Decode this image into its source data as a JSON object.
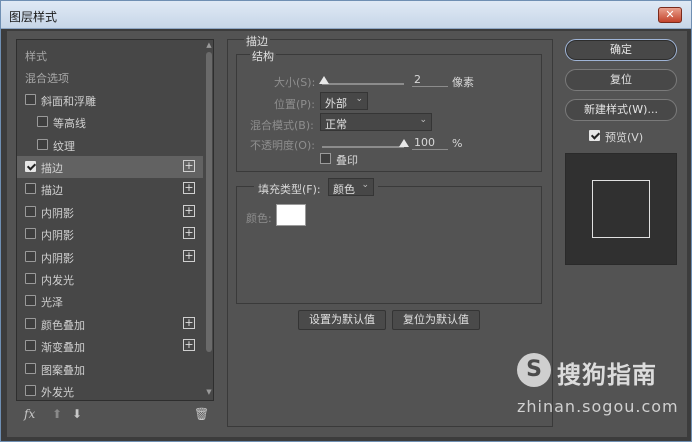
{
  "window": {
    "title": "图层样式",
    "close_label": "✕"
  },
  "styles_list": {
    "items": [
      {
        "label": "样式",
        "checkbox": false,
        "indent": 0,
        "plus": false,
        "checked": false,
        "selected": false
      },
      {
        "label": "混合选项",
        "checkbox": false,
        "indent": 0,
        "plus": false,
        "checked": false,
        "selected": false
      },
      {
        "label": "斜面和浮雕",
        "checkbox": true,
        "indent": 0,
        "plus": false,
        "checked": false,
        "selected": false
      },
      {
        "label": "等高线",
        "checkbox": true,
        "indent": 1,
        "plus": false,
        "checked": false,
        "selected": false
      },
      {
        "label": "纹理",
        "checkbox": true,
        "indent": 1,
        "plus": false,
        "checked": false,
        "selected": false
      },
      {
        "label": "描边",
        "checkbox": true,
        "indent": 0,
        "plus": true,
        "checked": true,
        "selected": true
      },
      {
        "label": "描边",
        "checkbox": true,
        "indent": 0,
        "plus": true,
        "checked": false,
        "selected": false
      },
      {
        "label": "内阴影",
        "checkbox": true,
        "indent": 0,
        "plus": true,
        "checked": false,
        "selected": false
      },
      {
        "label": "内阴影",
        "checkbox": true,
        "indent": 0,
        "plus": true,
        "checked": false,
        "selected": false
      },
      {
        "label": "内阴影",
        "checkbox": true,
        "indent": 0,
        "plus": true,
        "checked": false,
        "selected": false
      },
      {
        "label": "内发光",
        "checkbox": true,
        "indent": 0,
        "plus": false,
        "checked": false,
        "selected": false
      },
      {
        "label": "光泽",
        "checkbox": true,
        "indent": 0,
        "plus": false,
        "checked": false,
        "selected": false
      },
      {
        "label": "颜色叠加",
        "checkbox": true,
        "indent": 0,
        "plus": true,
        "checked": false,
        "selected": false
      },
      {
        "label": "渐变叠加",
        "checkbox": true,
        "indent": 0,
        "plus": true,
        "checked": false,
        "selected": false
      },
      {
        "label": "图案叠加",
        "checkbox": true,
        "indent": 0,
        "plus": false,
        "checked": false,
        "selected": false
      },
      {
        "label": "外发光",
        "checkbox": true,
        "indent": 0,
        "plus": false,
        "checked": false,
        "selected": false
      }
    ],
    "footer": {
      "fx_label": "fx",
      "up_icon": "arrow-up-icon",
      "down_icon": "arrow-down-icon",
      "trash_icon": "trash-icon"
    }
  },
  "stroke": {
    "section_title": "描边",
    "structure_title": "结构",
    "size_label": "大小(S):",
    "size_value": "2",
    "size_unit": "像素",
    "position_label": "位置(P):",
    "position_value": "外部",
    "blend_label": "混合模式(B):",
    "blend_value": "正常",
    "opacity_label": "不透明度(O):",
    "opacity_value": "100",
    "opacity_unit": "%",
    "opacity_level": 1.0,
    "size_level": 0.02,
    "overprint_label": "叠印",
    "fill_type_label": "填充类型(F):",
    "fill_type_value": "颜色",
    "color_label": "颜色:",
    "color_value": "#ffffff",
    "make_default_label": "设置为默认值",
    "reset_default_label": "复位为默认值"
  },
  "actions": {
    "ok_label": "确定",
    "reset_label": "复位",
    "new_style_label": "新建样式(W)...",
    "preview_label": "预览(V)",
    "preview_checked": true
  },
  "watermark": {
    "brand": "搜狗指南",
    "logo_letter": "S",
    "url": "zhinan.sogou.com"
  }
}
